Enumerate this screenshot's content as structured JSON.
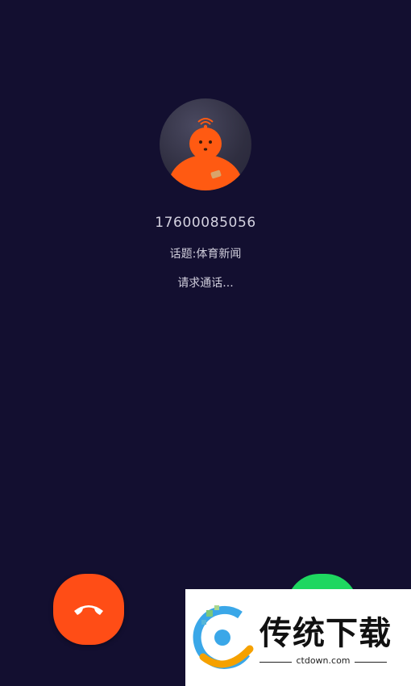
{
  "caller": {
    "number": "17600085056",
    "topic": "话题:体育新闻",
    "status": "请求通话..."
  },
  "actions": {
    "decline_icon": "hang-up-phone-icon",
    "accept_icon": "phone-icon"
  },
  "watermark": {
    "brand": "传统下载",
    "site": "ctdown.com"
  },
  "colors": {
    "background": "#130f30",
    "decline": "#ff4d16",
    "accept": "#1ed760",
    "avatar_orange": "#ff5a12"
  }
}
